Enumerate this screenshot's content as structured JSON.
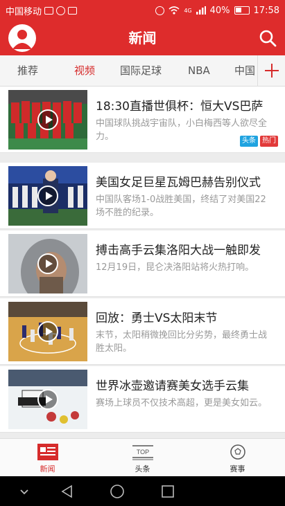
{
  "status_bar": {
    "carrier": "中国移动",
    "network": "4G",
    "battery": "40%",
    "time": "17:58"
  },
  "app_bar": {
    "title": "新闻",
    "icons": [
      "avatar-icon",
      "search-icon"
    ]
  },
  "tabs": [
    {
      "label": "推荐",
      "active": false
    },
    {
      "label": "视频",
      "active": true
    },
    {
      "label": "国际足球",
      "active": false
    },
    {
      "label": "NBA",
      "active": false
    },
    {
      "label": "中国",
      "active": false
    }
  ],
  "feed": [
    {
      "title": "18:30直播世俱杯：恒大VS巴萨",
      "desc": "中国球队挑战宇宙队，小白梅西等人欲尽全力。",
      "badges": [
        {
          "label": "头条",
          "color": "#1fa3e0"
        },
        {
          "label": "热门",
          "color": "#e23a3a"
        }
      ]
    },
    {
      "title": "美国女足巨星瓦姆巴赫告别仪式",
      "desc": "中国队客场1-0战胜美国，终结了对美国22场不胜的纪录。",
      "badges": []
    },
    {
      "title": "搏击高手云集洛阳大战一触即发",
      "desc": "12月19日，昆仑决洛阳站将火热打响。",
      "badges": []
    },
    {
      "title": "回放：勇士VS太阳末节",
      "desc": "末节，太阳稍微挽回比分劣势，最终勇士战胜太阳。",
      "badges": []
    },
    {
      "title": "世界冰壶邀请赛美女选手云集",
      "desc": "赛场上球员不仅技术高超，更是美女如云。",
      "badges": []
    }
  ],
  "bottom_nav": [
    {
      "label": "新闻",
      "icon": "news-icon",
      "active": true
    },
    {
      "label": "头条",
      "icon": "top-icon",
      "icon_text": "TOP",
      "active": false
    },
    {
      "label": "赛事",
      "icon": "ball-icon",
      "active": false
    }
  ],
  "colors": {
    "primary": "#de2c2c",
    "tab_active": "#d62b2b",
    "badge_blue": "#1fa3e0",
    "badge_red": "#e23a3a"
  }
}
